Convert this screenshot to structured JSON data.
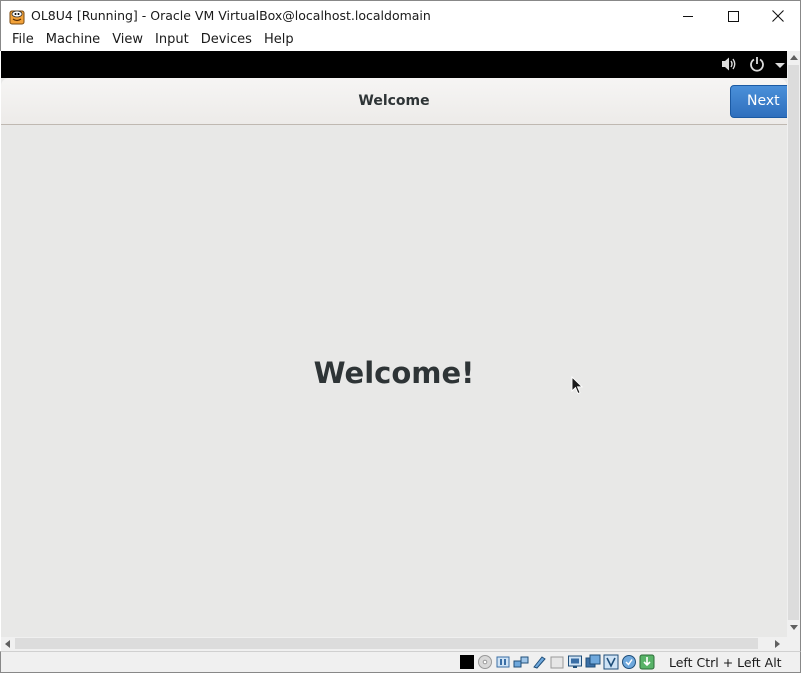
{
  "window": {
    "title": "OL8U4 [Running] - Oracle VM VirtualBox@localhost.localdomain",
    "app_icon": "virtualbox-icon",
    "controls": [
      "minimize-icon",
      "maximize-icon",
      "close-icon"
    ]
  },
  "menubar": {
    "items": [
      "File",
      "Machine",
      "View",
      "Input",
      "Devices",
      "Help"
    ]
  },
  "guest": {
    "topbar_icons": [
      "volume-icon",
      "power-icon",
      "dropdown-arrow-icon"
    ],
    "header_title": "Welcome",
    "next_label": "Next",
    "welcome_text": "Welcome!"
  },
  "statusbar": {
    "icons": [
      "display-icon",
      "optical-drive-icon",
      "audio-icon",
      "network-icon",
      "usb-icon",
      "shared-folders-icon",
      "display-settings-icon",
      "video-capture-icon",
      "cpu-icon",
      "mouse-integration-icon",
      "keyboard-icon"
    ],
    "host_key": "Left Ctrl + Left Alt"
  },
  "colors": {
    "guest_background": "#e8e8e7",
    "next_button": "#3a7fcf",
    "top_bar": "#000000"
  }
}
